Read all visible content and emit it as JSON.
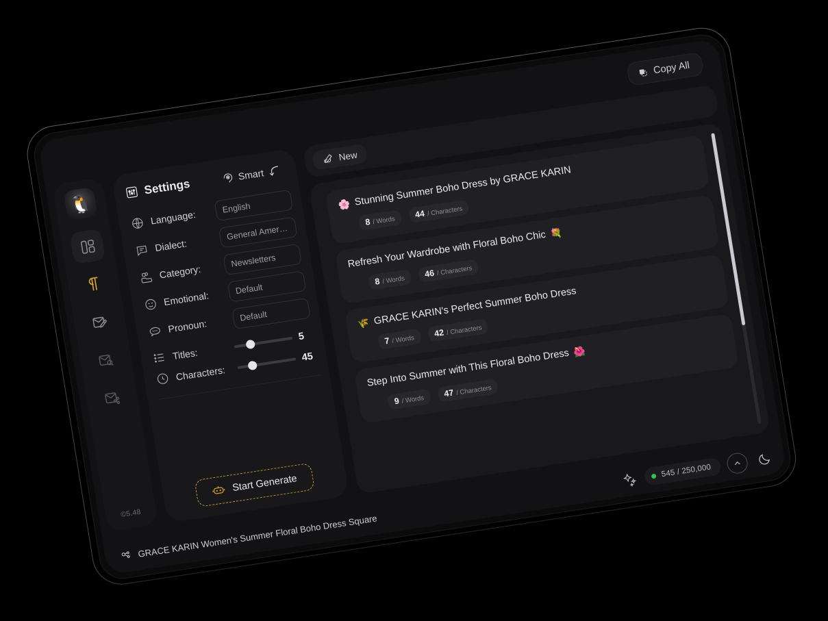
{
  "app": {
    "version": "©5.48",
    "avatar": "penguin-avatar"
  },
  "topbar": {
    "copy_all_label": "Copy All",
    "copy_all_icon": "copy-icon"
  },
  "rail": {
    "items": [
      {
        "name": "dashboard",
        "icon": "layout-dashboard-icon",
        "state": "boxed"
      },
      {
        "name": "paragraph",
        "icon": "pilcrow-icon",
        "state": "active"
      },
      {
        "name": "mail-compose",
        "icon": "mail-edit-icon",
        "state": "normal"
      },
      {
        "name": "mail-search",
        "icon": "mail-search-icon",
        "state": "dim"
      },
      {
        "name": "mail-share",
        "icon": "mail-share-icon",
        "state": "dim"
      }
    ]
  },
  "settings": {
    "title": "Settings",
    "title_icon": "sliders-icon",
    "smart": {
      "label": "Smart",
      "icon": "head-brain-icon",
      "arrow_icon": "arrow-curve-down-icon"
    },
    "fields": [
      {
        "label": "Language:",
        "icon": "globe-icon",
        "value": "English",
        "placeholder": "English"
      },
      {
        "label": "Dialect:",
        "icon": "speech-icon",
        "value": "General American",
        "placeholder": "General American"
      },
      {
        "label": "Category:",
        "icon": "folder-tag-icon",
        "value": "Newsletters",
        "placeholder": "Newsletters"
      },
      {
        "label": "Emotional:",
        "icon": "smiley-icon",
        "value": "Default",
        "placeholder": "Default"
      },
      {
        "label": "Pronoun:",
        "icon": "chat-dots-icon",
        "value": "Default",
        "placeholder": "Default"
      }
    ],
    "sliders": [
      {
        "label": "Titles:",
        "icon": "list-icon",
        "value": "5",
        "percent": 28
      },
      {
        "label": "Characters:",
        "icon": "clock-icon",
        "value": "45",
        "percent": 26
      }
    ],
    "generate": {
      "label": "Start Generate",
      "icon": "robot-icon"
    }
  },
  "results": {
    "tab": {
      "label": "New",
      "icon": "pen-write-icon"
    },
    "scroll": {
      "thumb_percent": 66,
      "thumb_offset_percent": 0
    },
    "cards": [
      {
        "emoji": "🌸",
        "emoji_position": "before",
        "title": "Stunning Summer Boho Dress by GRACE KARIN",
        "words": "8",
        "words_label": "/ Words",
        "characters": "44",
        "characters_label": "/ Characters"
      },
      {
        "emoji": "💐",
        "emoji_position": "after",
        "title": "Refresh Your Wardrobe with Floral Boho Chic",
        "words": "8",
        "words_label": "/ Words",
        "characters": "46",
        "characters_label": "/ Characters"
      },
      {
        "emoji": "🌾",
        "emoji_position": "before",
        "title": "GRACE KARIN's Perfect Summer Boho Dress",
        "words": "7",
        "words_label": "/ Words",
        "characters": "42",
        "characters_label": "/ Characters"
      },
      {
        "emoji": "🌺",
        "emoji_position": "after",
        "title": "Step Into Summer with This Floral Boho Dress",
        "words": "9",
        "words_label": "/ Words",
        "characters": "47",
        "characters_label": "/ Characters"
      }
    ]
  },
  "bottombar": {
    "source_icon": "share-nodes-icon",
    "source_title": "GRACE KARIN Women's Summer Floral Boho Dress Square",
    "sparkle_icon": "sparkles-icon",
    "quota": "545 / 250,000",
    "status_dot_color": "#37c24a",
    "collapse_icon": "chevron-up-circle-icon",
    "theme_icon": "moon-icon"
  },
  "colors": {
    "accent": "#d6a328",
    "screen_bg": "#121214",
    "panel_bg": "#18181b",
    "card_bg": "#202024",
    "text": "#eaeaee"
  }
}
